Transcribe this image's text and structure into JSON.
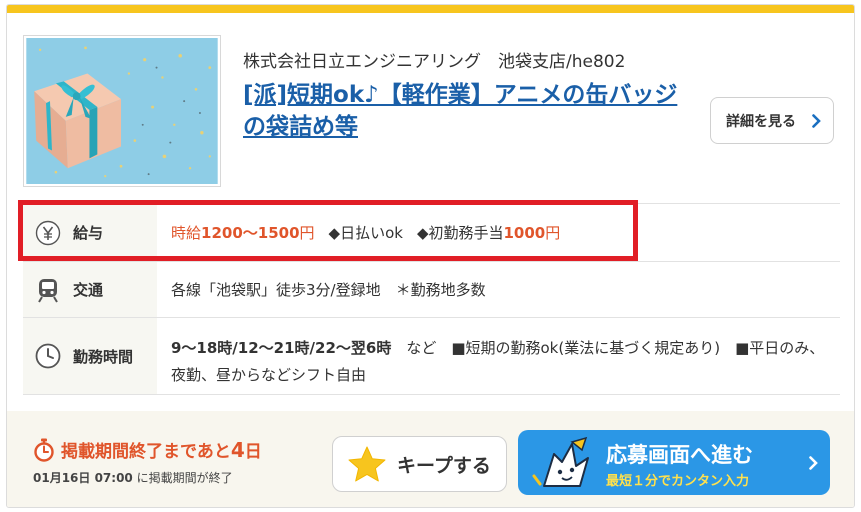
{
  "job": {
    "company": "株式会社日立エンジニアリング　池袋支店/he802",
    "title": "[派]短期ok♪【軽作業】アニメの缶バッジの袋詰め等",
    "image_icon": "gift-box-photo"
  },
  "detail_button": {
    "label": "詳細を見る",
    "icon": "chevron-right-icon"
  },
  "rows": {
    "salary": {
      "label": "給与",
      "icon": "yen-icon",
      "hourly_prefix": "時給",
      "hourly_range": "1200〜1500",
      "hourly_unit": "円",
      "perk1": "◆日払いok",
      "perk2_prefix": "◆初勤務手当",
      "perk2_amount": "1000",
      "perk2_unit": "円"
    },
    "access": {
      "label": "交通",
      "icon": "train-icon",
      "text": "各線「池袋駅」徒歩3分/登録地　＊勤務地多数"
    },
    "hours": {
      "label": "勤務時間",
      "icon": "clock-icon",
      "bold": "9〜18時/12〜21時/22〜翌6時",
      "text": "　など　■短期の勤務ok(業法に基づく規定あり)　■平日のみ、夜勤、昼からなどシフト自由"
    }
  },
  "footer": {
    "deadline_prefix": "掲載期間終了まであと",
    "deadline_days": "4",
    "deadline_unit": "日",
    "end_date": "01月16日 07:00",
    "end_note": " に掲載期間が終了",
    "keep_label": "キープする",
    "apply_main": "応募画面へ進む",
    "apply_sub": "最短１分でカンタン入力"
  },
  "colors": {
    "accent_yellow": "#f7c51e",
    "link_blue": "#1a5fa8",
    "salary_orange": "#e0552b",
    "apply_blue": "#2b97e6",
    "highlight_red": "#e11e26"
  }
}
